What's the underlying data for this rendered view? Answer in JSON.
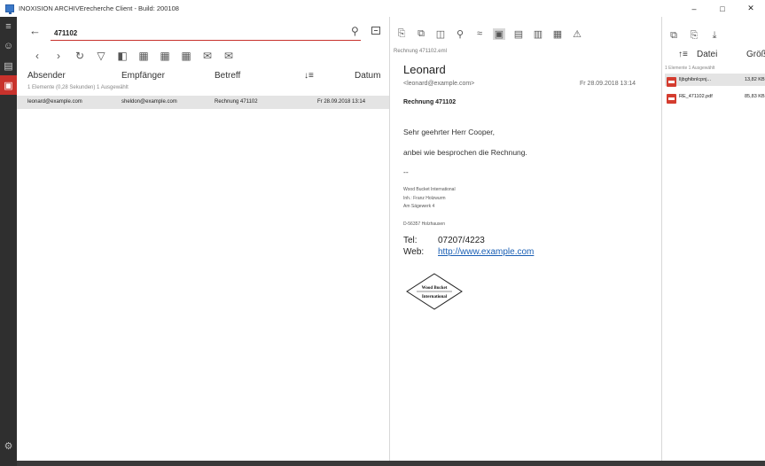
{
  "window": {
    "title": "INOXISION ARCHIVErecherche Client - Build: 200108",
    "minimize": "–",
    "maximize": "□",
    "close": "✕"
  },
  "search": {
    "value": "471102"
  },
  "columns": [
    "Absender",
    "Empfänger",
    "Betreff",
    "Datum"
  ],
  "results_info": "1 Elemente (0,28 Sekunden)   1 Ausgewählt",
  "results": [
    {
      "sender": "leonard@example.com",
      "recipient": "sheldon@example.com",
      "subject": "Rechnung 471102",
      "date": "Fr  28.09.2018  13:14"
    }
  ],
  "preview": {
    "filename": "Rechnung 471102.eml",
    "sender_name": "Leonard",
    "sender_email": "<leonard@example.com>",
    "date": "Fr  28.09.2018  13:14",
    "subject": "Rechnung 471102",
    "greeting": "Sehr geehrter Herr Cooper,",
    "body": "anbei wie besprochen die Rechnung.",
    "separator": "--",
    "company": "Wood Bucket International",
    "owner": "Inh.: Franz Holzwurm",
    "street": "Am Sägewerk 4",
    "city": "D-56357 Holzhausen",
    "tel_label": "Tel:",
    "tel_value": "07207/4223",
    "web_label": "Web:",
    "web_value": "http://www.example.com",
    "logo_line1": "Wood Bucket",
    "logo_line2": "International"
  },
  "attachments_panel": {
    "col_file": "Datei",
    "col_size": "Größe",
    "info": "1 Elemente   1 Ausgewählt",
    "files": [
      {
        "name": "lljbghibnlcpnj...",
        "size": "13,82 KB"
      },
      {
        "name": "RE_471102.pdf",
        "size": "85,83 KB"
      }
    ]
  },
  "colors": {
    "accent": "#c8322c",
    "rail": "#2f2f2f",
    "selection": "#e4e4e4",
    "link": "#1a5fb4"
  },
  "icons": {
    "rail": [
      "hamburger-icon",
      "person-icon",
      "document-icon",
      "archive-icon"
    ],
    "rail_bottom": "gear-icon"
  }
}
